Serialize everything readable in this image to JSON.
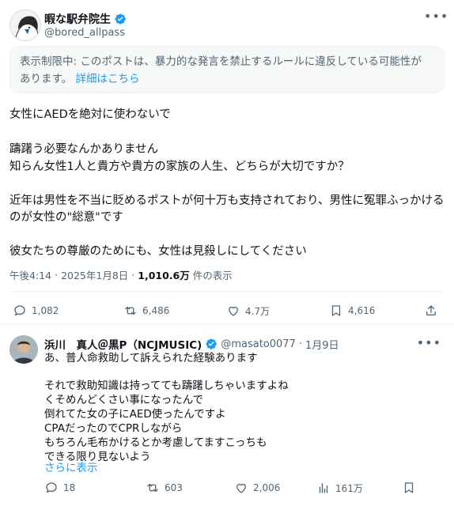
{
  "post": {
    "author": {
      "name": "暇な駅弁院生",
      "handle": "@bored_allpass",
      "verified": true,
      "avatar_icon": "anime-character-avatar-icon"
    },
    "more_icon": "more-options-icon",
    "notice": {
      "text": "表示制限中: このポストは、暴力的な発言を禁止するルールに違反している可能性があります。",
      "line1": "表示制限中: このポストは、暴力的な発言を禁止するルールに違反している可能性が",
      "line2": "あります。",
      "link": "詳細はこちら"
    },
    "lines": [
      "女性にAEDを絶対に使わないで",
      "",
      "躊躇う必要なんかありません",
      "知らん女性1人と貴方や貴方の家族の人生、どちらが大切ですか？",
      "",
      "近年は男性を不当に貶めるポストが何十万も支持されており、男性に冤罪ふっかける",
      "のが女性の\"総意\"です",
      "",
      "彼女たちの尊厳のためにも、女性は見殺しにしてください"
    ],
    "meta": {
      "time": "午後4:14",
      "sep1": "·",
      "date": "2025年1月8日",
      "sep2": "·",
      "views": "1,010.6万",
      "views_label": "件の表示"
    },
    "actions": {
      "replies": "1,082",
      "reposts": "6,486",
      "likes": "4.7万",
      "bookmarks": "4,616"
    }
  },
  "reply": {
    "name": "浜川　真人＠黒P（NCJMUSIC)",
    "verified": true,
    "handle": "@masato0077",
    "dot": "·",
    "date": "1月9日",
    "lines": [
      "あ、普人命救助して訴えられた経験あります",
      "",
      "それで救助知識は持ってても躊躇しちゃいますよね",
      "くそめんどくさい事になったんで",
      "倒れてた女の子にAED使ったんですよ",
      "CPAだったのでCPRしながら",
      "もちろん毛布かけるとか考慮してますこっちも",
      "できる限り見ないよう"
    ],
    "show_more": "さらに表示",
    "actions": {
      "replies": "18",
      "reposts": "603",
      "likes": "2,006",
      "views": "161万"
    }
  },
  "colors": {
    "accent": "#1d9bf0",
    "text": "#0f1419",
    "muted": "#536471",
    "notice_bg": "#f7f9f9"
  }
}
